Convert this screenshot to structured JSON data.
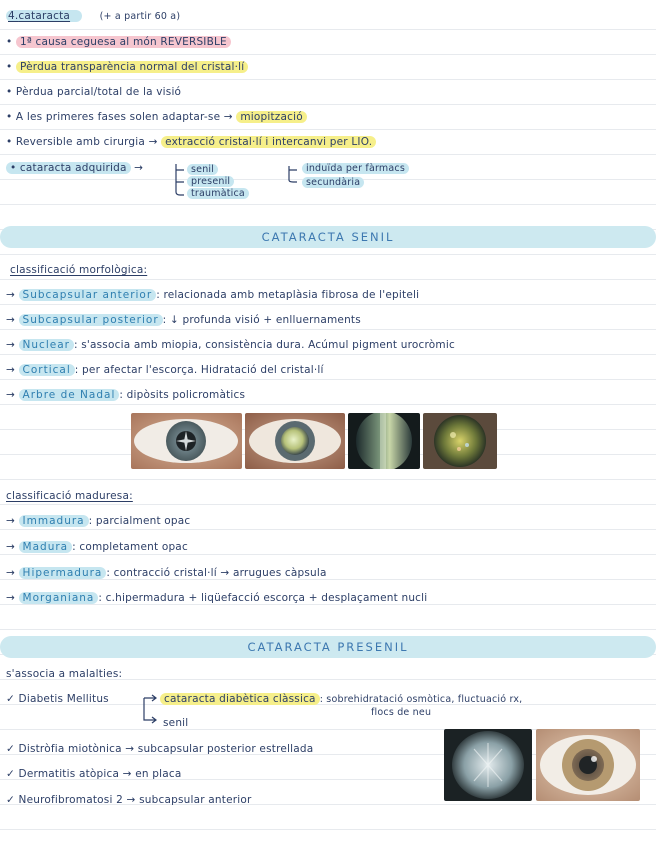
{
  "title": {
    "num": "4.",
    "word": "cataracta",
    "note": "(+ a partir 60 a)"
  },
  "bullets": [
    {
      "pre": "• ",
      "hl": "1ª causa ceguesa al món REVERSIBLE",
      "post": ""
    },
    {
      "pre": "• ",
      "hl": "Pèrdua transparència normal del cristal·lí",
      "post": ""
    },
    {
      "pre": "• Pèrdua parcial/total de la visió",
      "hl": "",
      "post": ""
    },
    {
      "pre": "• A les primeres fases solen adaptar-se → ",
      "hl": "miopització",
      "post": ""
    },
    {
      "pre": "• Reversible amb cirurgia → ",
      "hl": "extracció cristal·lí i intercanvi per LIO.",
      "post": ""
    }
  ],
  "acquired": {
    "label": "• cataracta adquirida",
    "arrow": "→",
    "types": [
      "senil",
      "presenil",
      "traumàtica"
    ],
    "sub": [
      "induïda per fàrmacs",
      "secundària"
    ]
  },
  "senil": {
    "banner": "CATARACTA SENIL",
    "morph_heading": "classificació morfològica:",
    "morph": [
      {
        "term": "Subcapsular anterior",
        "desc": ": relacionada amb metaplàsia fibrosa de l'epiteli"
      },
      {
        "term": "Subcapsular posterior",
        "desc": ": ↓ profunda visió + enlluernaments"
      },
      {
        "term": "Nuclear",
        "desc": ": s'associa amb miopia, consistència dura. Acúmul pigment urocròmic"
      },
      {
        "term": "Cortical",
        "desc": ": per afectar l'escorça. Hidratació del cristal·lí"
      },
      {
        "term": "Arbre de Nadal",
        "desc": ": dipòsits policromàtics"
      }
    ],
    "mat_heading": "classificació maduresa:",
    "mat": [
      {
        "term": "Immadura",
        "desc": ": parcialment opac"
      },
      {
        "term": "Madura",
        "desc": ": completament opac"
      },
      {
        "term": "Hipermadura",
        "desc": ": contracció cristal·lí → arrugues càpsula"
      },
      {
        "term": "Morganiana",
        "desc": ": c.hipermadura + liqüefacció escorça + desplaçament nucli"
      }
    ]
  },
  "presenil": {
    "banner": "CATARACTA PRESENIL",
    "intro": "s'associa a malalties:",
    "dm_label": "✓ Diabetis Mellitus",
    "dm_hl": "cataracta diabètica clàssica",
    "dm_desc1": ": sobrehidratació osmòtica, fluctuació rx,",
    "dm_desc2": "flocs de neu",
    "dm_alt": "senil",
    "items": [
      "✓ Distròfia miotònica → subcapsular posterior estrellada",
      "✓ Dermatitis atòpica → en placa",
      "✓ Neurofibromatosi 2 → subcapsular anterior"
    ]
  },
  "colors": {
    "pink": "#f6c6cf",
    "yellow": "#f6ef8a",
    "blue": "#c6e6f0",
    "ink": "#2c3e66",
    "accent": "#2f7fb0"
  }
}
